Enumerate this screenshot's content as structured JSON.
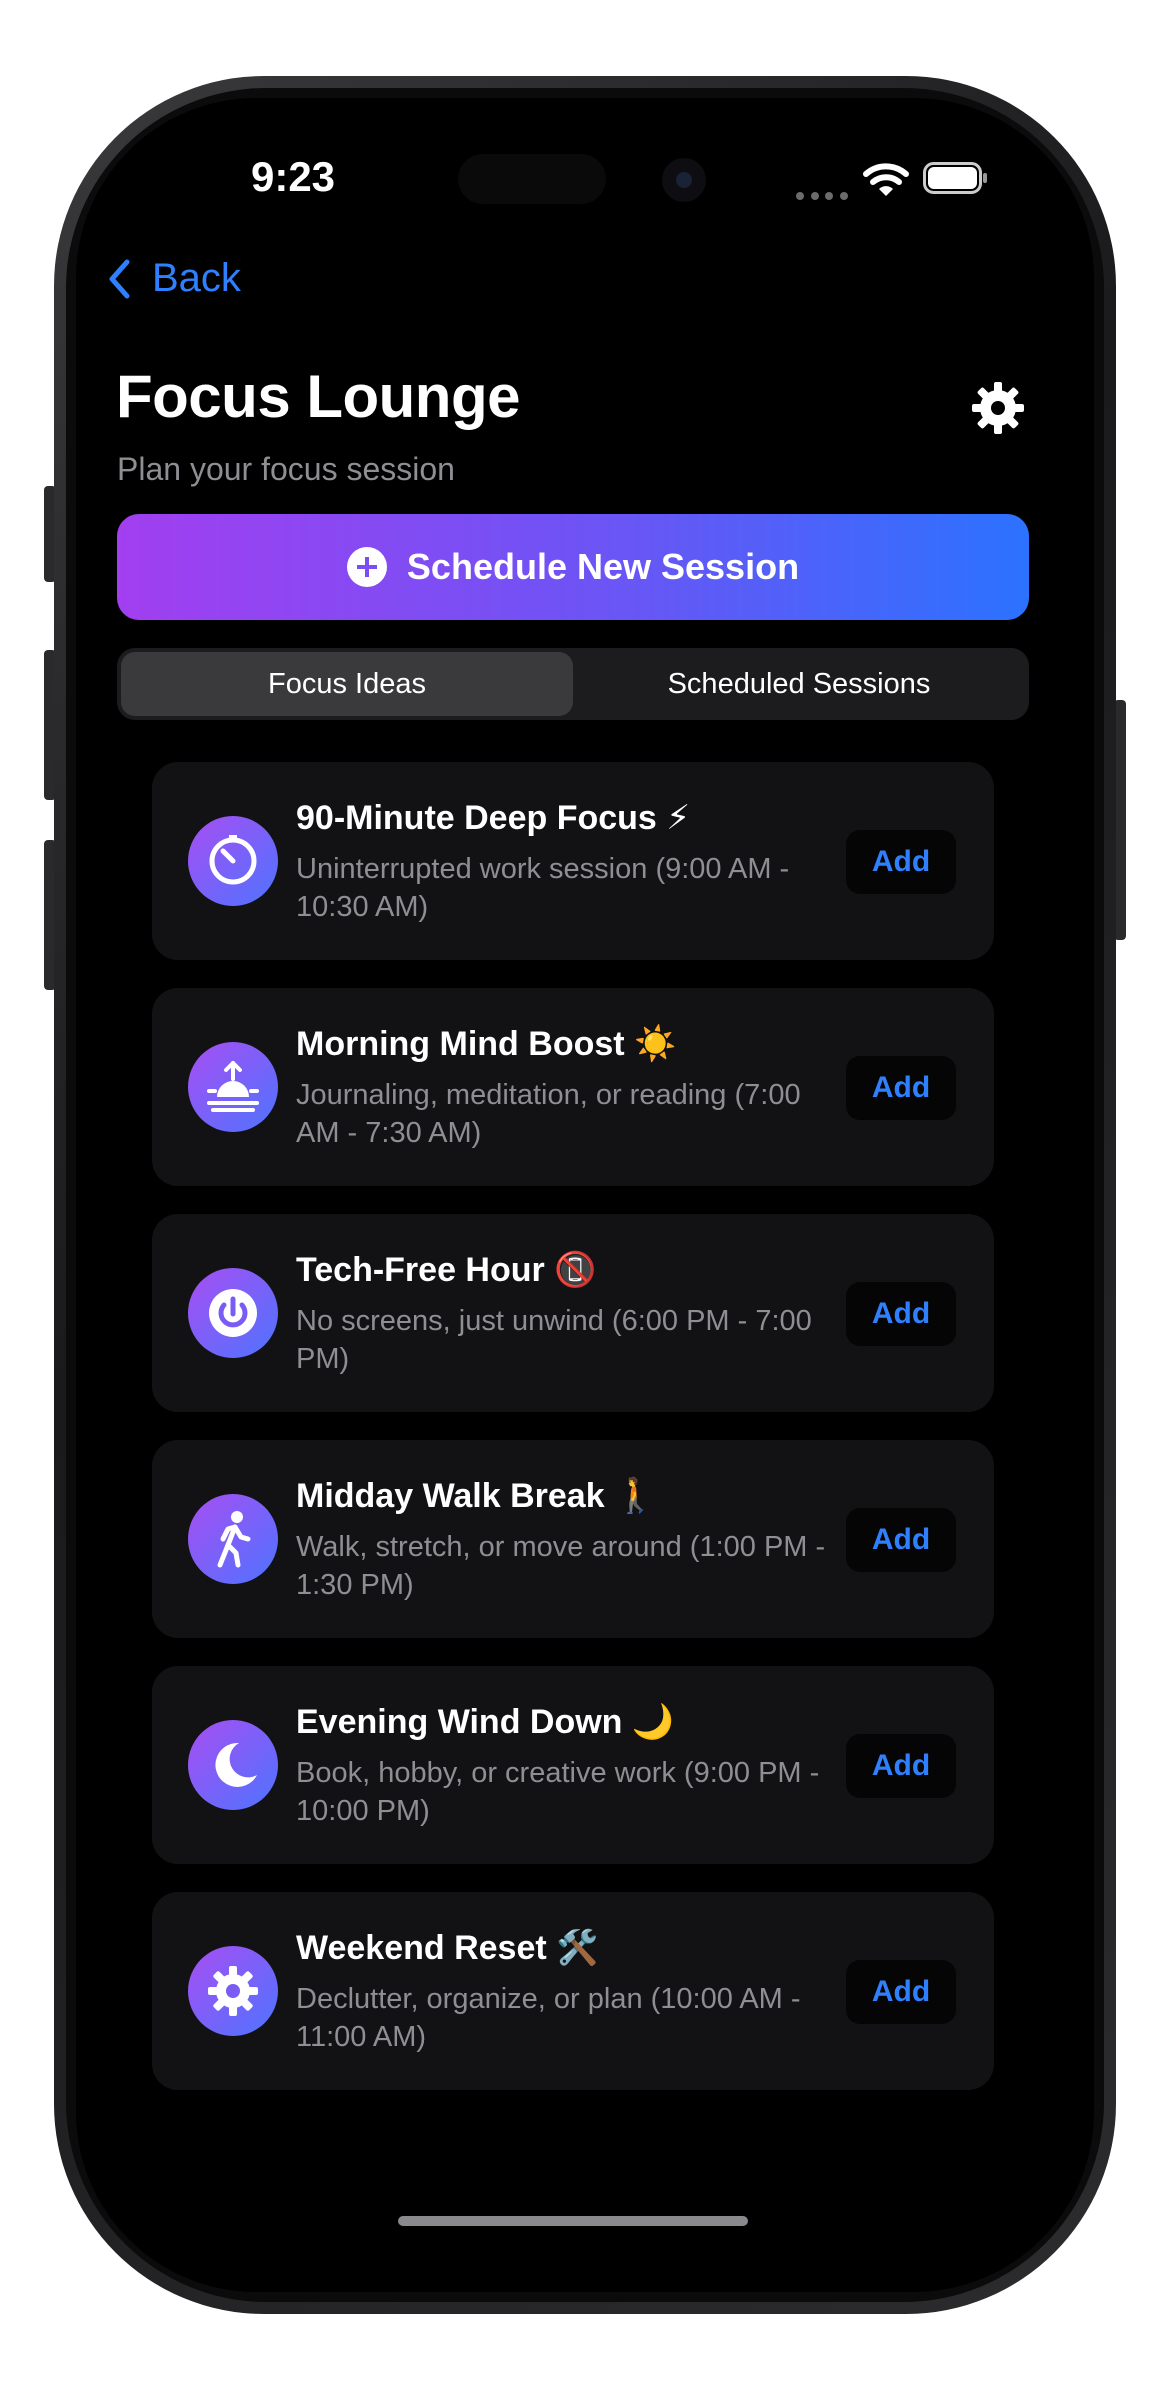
{
  "status_bar": {
    "time": "9:23"
  },
  "nav": {
    "back_label": "Back"
  },
  "header": {
    "title": "Focus Lounge",
    "subtitle": "Plan your focus session"
  },
  "primary_button": {
    "label": "Schedule New Session"
  },
  "segments": [
    {
      "label": "Focus Ideas",
      "selected": true
    },
    {
      "label": "Scheduled Sessions",
      "selected": false
    }
  ],
  "ideas": [
    {
      "title": "90-Minute Deep Focus ⚡",
      "description": "Uninterrupted work session (9:00 AM - 10:30 AM)",
      "icon": "timer-icon",
      "action": "Add"
    },
    {
      "title": "Morning Mind Boost ☀️",
      "description": "Journaling, meditation, or reading (7:00 AM - 7:30 AM)",
      "icon": "sunrise-icon",
      "action": "Add"
    },
    {
      "title": "Tech-Free Hour 📵",
      "description": "No screens, just unwind (6:00 PM - 7:00 PM)",
      "icon": "power-icon",
      "action": "Add"
    },
    {
      "title": "Midday Walk Break 🚶",
      "description": "Walk, stretch, or move around (1:00 PM - 1:30 PM)",
      "icon": "walking-icon",
      "action": "Add"
    },
    {
      "title": "Evening Wind Down 🌙",
      "description": "Book, hobby, or creative work (9:00 PM - 10:00 PM)",
      "icon": "moon-icon",
      "action": "Add"
    },
    {
      "title": "Weekend Reset 🛠️",
      "description": "Declutter, organize, or plan (10:00 AM - 11:00 AM)",
      "icon": "gear-icon",
      "action": "Add"
    }
  ],
  "colors": {
    "accent": "#2f80ff",
    "gradient_start": "#a23ff0",
    "gradient_end": "#2c72ff",
    "card_bg": "#121214"
  }
}
